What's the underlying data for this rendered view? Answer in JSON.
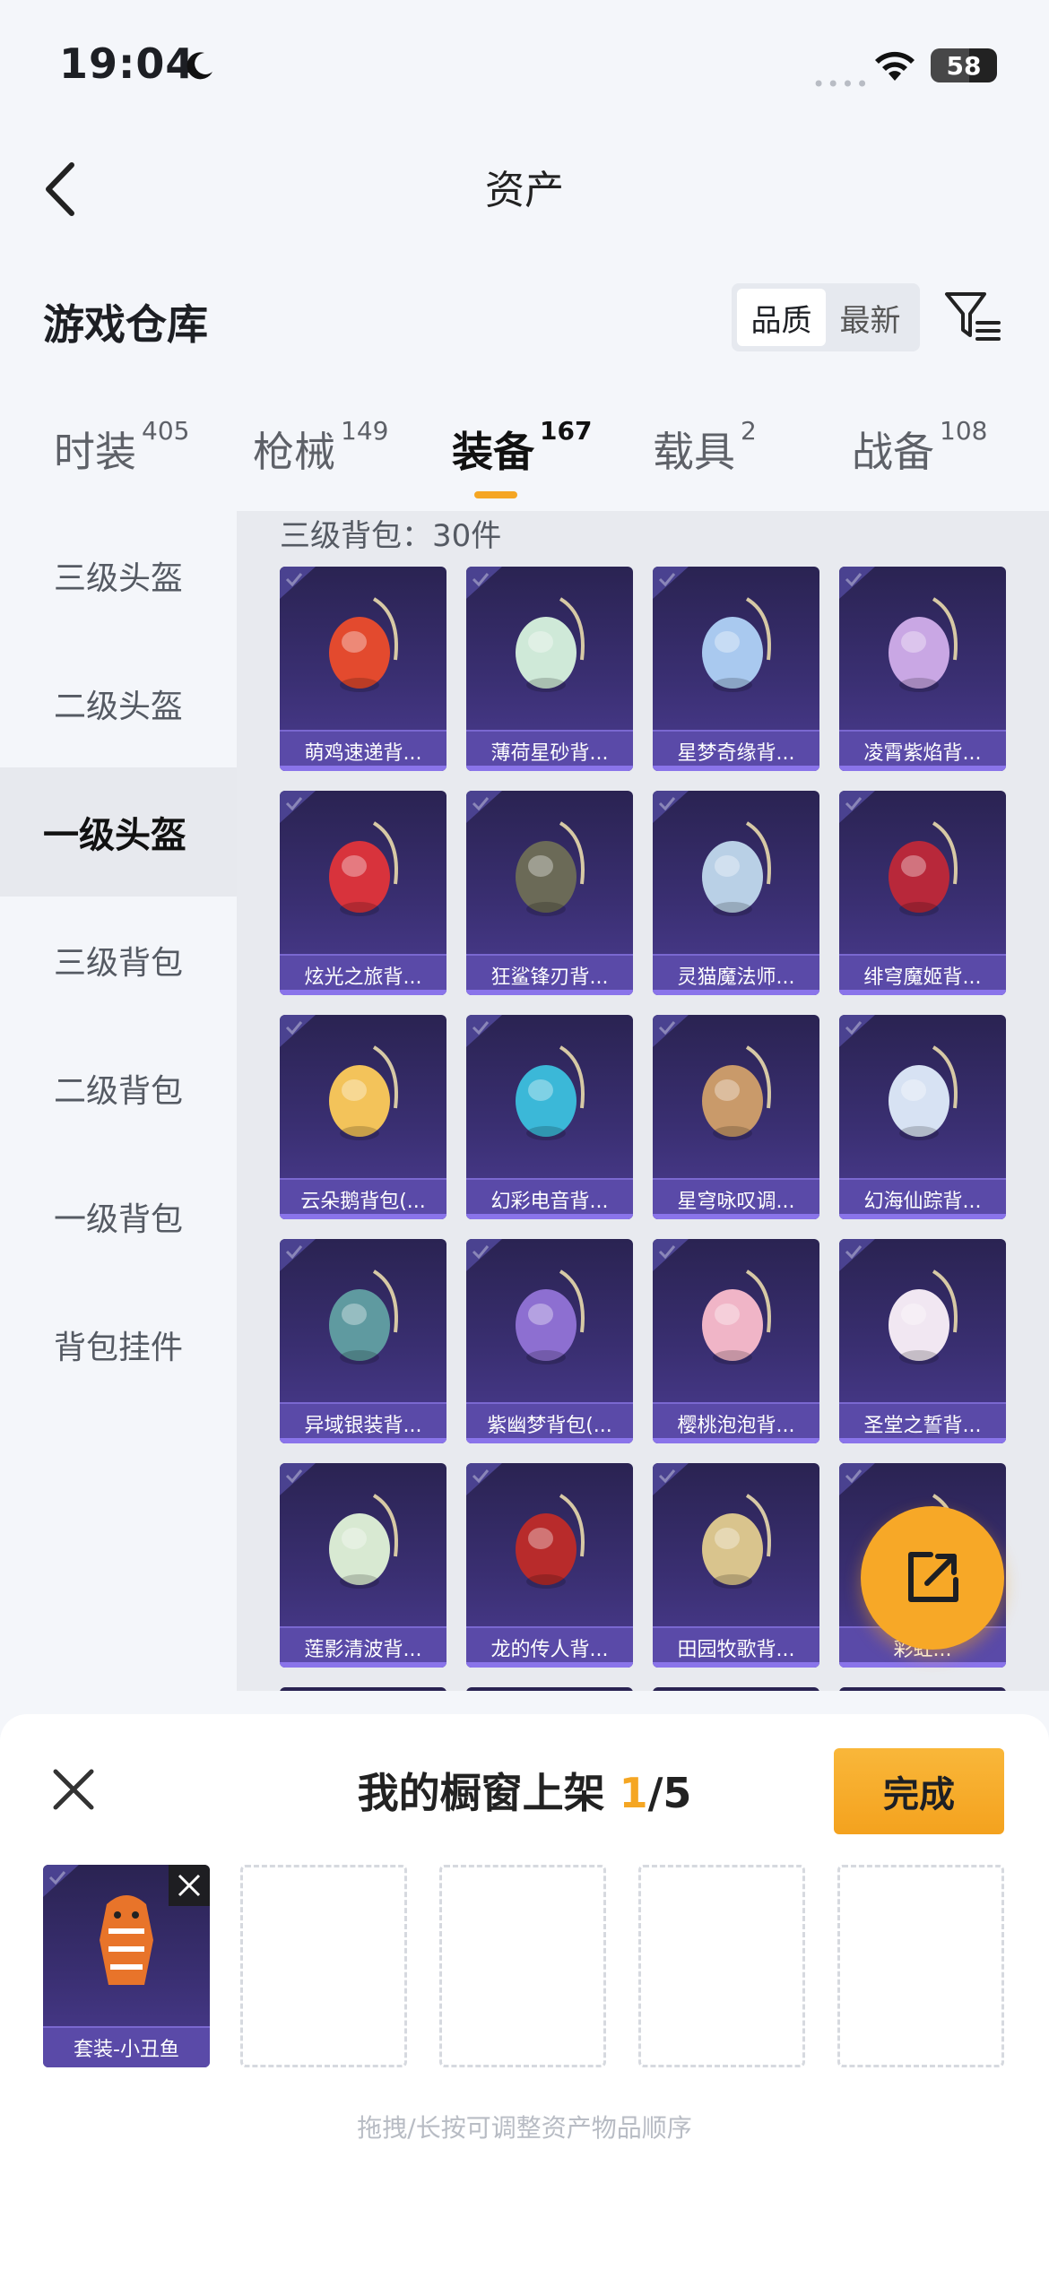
{
  "status": {
    "time": "19:04",
    "battery": "58",
    "battery_level": 0.58
  },
  "nav": {
    "title": "资产"
  },
  "header": {
    "title": "游戏仓库",
    "sort_options": [
      "品质",
      "最新"
    ],
    "sort_selected": "品质"
  },
  "tabs": [
    {
      "label": "时装",
      "count": "405"
    },
    {
      "label": "枪械",
      "count": "149"
    },
    {
      "label": "装备",
      "count": "167",
      "active": true
    },
    {
      "label": "载具",
      "count": "2"
    },
    {
      "label": "战备",
      "count": "108"
    }
  ],
  "sidebar": {
    "items": [
      {
        "label": "三级头盔"
      },
      {
        "label": "二级头盔"
      },
      {
        "label": "一级头盔",
        "active": true
      },
      {
        "label": "三级背包"
      },
      {
        "label": "二级背包"
      },
      {
        "label": "一级背包"
      },
      {
        "label": "背包挂件"
      }
    ]
  },
  "section": {
    "title": "三级背包：30件"
  },
  "items": [
    {
      "label": "萌鸡速递背...",
      "icon": "chick-backpack-icon",
      "color": "#e34a2e"
    },
    {
      "label": "薄荷星砂背...",
      "icon": "mint-pouch-icon",
      "color": "#cfe9d8"
    },
    {
      "label": "星梦奇缘背...",
      "icon": "swan-backpack-icon",
      "color": "#a9c9ef"
    },
    {
      "label": "凌霄紫焰背...",
      "icon": "purple-flame-backpack-icon",
      "color": "#c9a7e4"
    },
    {
      "label": "炫光之旅背...",
      "icon": "monster-backpack-icon",
      "color": "#d8333c"
    },
    {
      "label": "狂鲨锋刃背...",
      "icon": "shark-backpack-icon",
      "color": "#6b6a57"
    },
    {
      "label": "灵猫魔法师...",
      "icon": "cat-wizard-backpack-icon",
      "color": "#b9d0e6"
    },
    {
      "label": "绯穹魔姬背...",
      "icon": "bat-backpack-icon",
      "color": "#b8283a"
    },
    {
      "label": "云朵鹅背包(...",
      "icon": "lion-backpack-icon",
      "color": "#f3c35a"
    },
    {
      "label": "幻彩电音背...",
      "icon": "music-backpack-icon",
      "color": "#3bb8d8"
    },
    {
      "label": "星穹咏叹调...",
      "icon": "gold-frame-backpack-icon",
      "color": "#c99a6a"
    },
    {
      "label": "幻海仙踪背...",
      "icon": "crystal-backpack-icon",
      "color": "#d7e2f3"
    },
    {
      "label": "异域银装背...",
      "icon": "tech-backpack-icon",
      "color": "#5f9aa0"
    },
    {
      "label": "紫幽梦背包(...",
      "icon": "violet-flower-backpack-icon",
      "color": "#8d6fd1"
    },
    {
      "label": "樱桃泡泡背...",
      "icon": "bow-backpack-icon",
      "color": "#f0b5c7"
    },
    {
      "label": "圣堂之誓背...",
      "icon": "wing-backpack-icon",
      "color": "#f1e7f2"
    },
    {
      "label": "莲影清波背...",
      "icon": "lotus-backpack-icon",
      "color": "#d8e9d2"
    },
    {
      "label": "龙的传人背...",
      "icon": "dragon-backpack-icon",
      "color": "#b82b2b"
    },
    {
      "label": "田园牧歌背...",
      "icon": "basket-backpack-icon",
      "color": "#d9c48d"
    },
    {
      "label": "彩虹...",
      "icon": "rainbow-backpack-icon",
      "color": "#e0b266"
    }
  ],
  "showcase": {
    "title": "我的橱窗上架",
    "current": "1",
    "total": "/5",
    "done_label": "完成",
    "slot_item": {
      "label": "套装-小丑鱼",
      "icon": "clownfish-suit-icon",
      "color": "#e8742a"
    },
    "hint": "拖拽/长按可调整资产物品顺序"
  }
}
